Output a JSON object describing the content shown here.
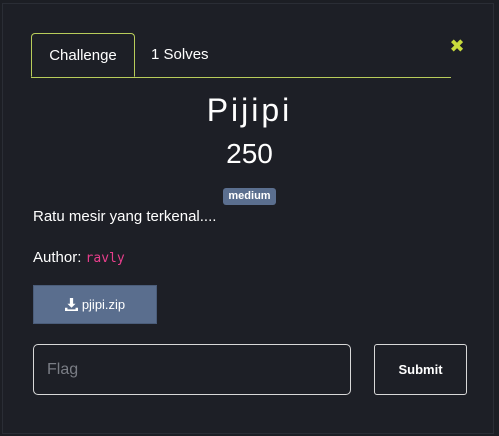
{
  "tabs": [
    {
      "label": "Challenge",
      "active": true
    },
    {
      "label": "1 Solves",
      "active": false
    }
  ],
  "close_icon": "close-icon",
  "challenge": {
    "name": "Pijipi",
    "points": "250",
    "difficulty": "medium",
    "description": "Ratu mesir yang terkenal....",
    "author_label": "Author:",
    "author_name": "ravly"
  },
  "file": {
    "icon": "download-icon",
    "name": "pjipi.zip"
  },
  "flag_input": {
    "value": "",
    "placeholder": "Flag"
  },
  "submit": {
    "label": "Submit"
  },
  "colors": {
    "background": "#1d1f26",
    "accent_tab_border": "#b8cc5a",
    "close_icon": "#c8dc3c",
    "badge_bg": "#5b6f8f",
    "file_button_bg": "#5a6e8e",
    "author_code": "#e83e8c"
  }
}
